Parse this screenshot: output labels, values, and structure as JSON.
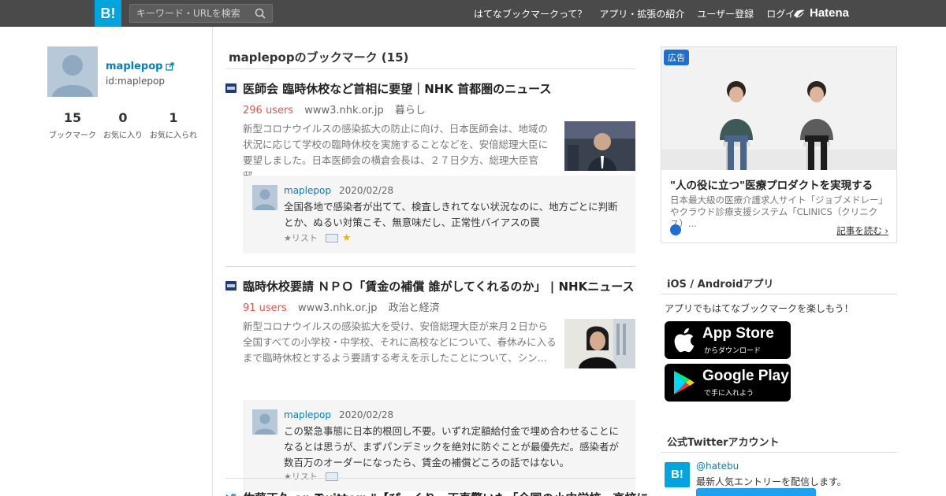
{
  "header": {
    "logo": "B!",
    "search_placeholder": "キーワード・URLを検索",
    "nav": [
      "はてなブックマークって？",
      "アプリ・拡張の紹介",
      "ユーザー登録",
      "ログイン"
    ],
    "hatena_logo": "Hatena"
  },
  "profile": {
    "name": "maplepop",
    "id": "id:maplepop",
    "stats": [
      {
        "num": "15",
        "label": "ブックマーク"
      },
      {
        "num": "0",
        "label": "お気に入り"
      },
      {
        "num": "1",
        "label": "お気に入られ"
      }
    ]
  },
  "main": {
    "title": "maplepopのブックマーク (15)",
    "entries": [
      {
        "title": "医師会 臨時休校など首相に要望｜NHK 首都圏のニュース",
        "users": "296 users",
        "domain": "www3.nhk.or.jp",
        "category": "暮らし",
        "summary": "新型コロナウイルスの感染拡大の防止に向け、日本医師会は、地域の状況に応じて学校の臨時休校を実施することなどを、安倍総理大臣に要望しました。日本医師会の横倉会長は、２７日夕方、総理大臣官邸...",
        "comment_user": "maplepop",
        "comment_date": "2020/02/28",
        "comment_text": "全国各地で感染者が出てて、検査しきれてない状況なのに、地方ごとに判断とか、ぬるい対策こそ、無意味だし、正常性バイアスの罠",
        "list_label": "★リスト",
        "gold_star": "★"
      },
      {
        "title": "臨時休校要請 ＮＰＯ「賃金の補償 誰がしてくれるのか」 | NHKニュース",
        "users": "91 users",
        "domain": "www3.nhk.or.jp",
        "category": "政治と経済",
        "summary": "新型コロナウイルスの感染拡大を受け、安倍総理大臣が来月２日から全国すべての小学校・中学校、それに高校などについて、春休みに入るまで臨時休校とするよう要請する考えを示したことについて、シン...",
        "comment_user": "maplepop",
        "comment_date": "2020/02/28",
        "comment_text": "この緊急事態に日本的根回し不要。いずれ定額給付金で埋め合わせることになるとは思うが、まずパンデミックを絶対に防ぐことが最優先だ。感染者が数百万のオーダーになったら、賃金の補償どころの話ではない。",
        "list_label": "★リスト"
      },
      {
        "title": "佐藤正久 on Twitter: \"【ぴっくり、正直驚いた「全国の小中学校、高校に"
      }
    ]
  },
  "sidebar": {
    "ad": {
      "badge": "広告",
      "title": "\"人の役に立つ\"医療プロダクトを実現する",
      "desc": "日本最大級の医療介護求人サイト「ジョブメドレー」やクラウド診療支援システム「CLINICS（クリニクス）...",
      "link": "記事を読む"
    },
    "apps": {
      "heading": "iOS / Androidアプリ",
      "text": "アプリでもはてなブックマークを楽しもう！",
      "appstore_big": "App Store",
      "appstore_small": "からダウンロード",
      "googleplay_big": "Google Play",
      "googleplay_small": "で手に入れよう"
    },
    "twitter": {
      "heading": "公式Twitterアカウント",
      "icon": "B!",
      "handle": "@hatebu",
      "desc": "最新人気エントリーを配信します。"
    }
  }
}
